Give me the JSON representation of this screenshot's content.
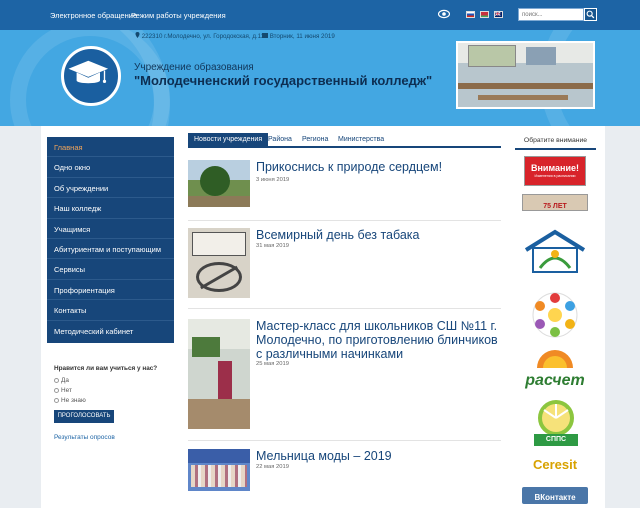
{
  "topbar": {
    "links": [
      "Электронное обращение",
      "Режим работы учреждения"
    ],
    "search_placeholder": "поиск..."
  },
  "header": {
    "address": "222310 г.Молодечно, ул. Городокская, д.111",
    "date": "Вторник, 11 июня 2019",
    "subtitle": "Учреждение образования",
    "title": "\"Молодечненский государственный колледж\""
  },
  "sidebar": {
    "items": [
      "Главная",
      "Одно окно",
      "Об учреждении",
      "Наш колледж",
      "Учащимся",
      "Абитуриентам и поступающим",
      "Сервисы",
      "Профориентация",
      "Контакты",
      "Методический кабинет"
    ]
  },
  "poll": {
    "question": "Нравится ли вам учиться у нас?",
    "options": [
      "Да",
      "Нет",
      "Не знаю"
    ],
    "vote_label": "ПРОГОЛОСОВАТЬ",
    "results_label": "Результаты опросов"
  },
  "tabs": [
    "Новости учреждения",
    "Района",
    "Региона",
    "Министерства"
  ],
  "news": [
    {
      "title": "Прикоснись к природе сердцем!",
      "date": "3 июня 2019"
    },
    {
      "title": "Всемирный день без табака",
      "date": "31 мая 2019"
    },
    {
      "title": "Мастер-класс для школьников СШ №11 г. Молодечно, по приготовлению блинчиков с различными начинками",
      "date": "25 мая 2019"
    },
    {
      "title": "Мельница моды – 2019",
      "date": "22 мая 2019"
    }
  ],
  "right": {
    "heading": "Обратите внимание",
    "attention": "Внимание!",
    "attention_sub": "Изменения в расписании",
    "years": "75 ЛЕТ",
    "raschet": "расчет",
    "spps": "СППС",
    "ceresit": "Ceresit",
    "vk": "ВКонтакте"
  }
}
